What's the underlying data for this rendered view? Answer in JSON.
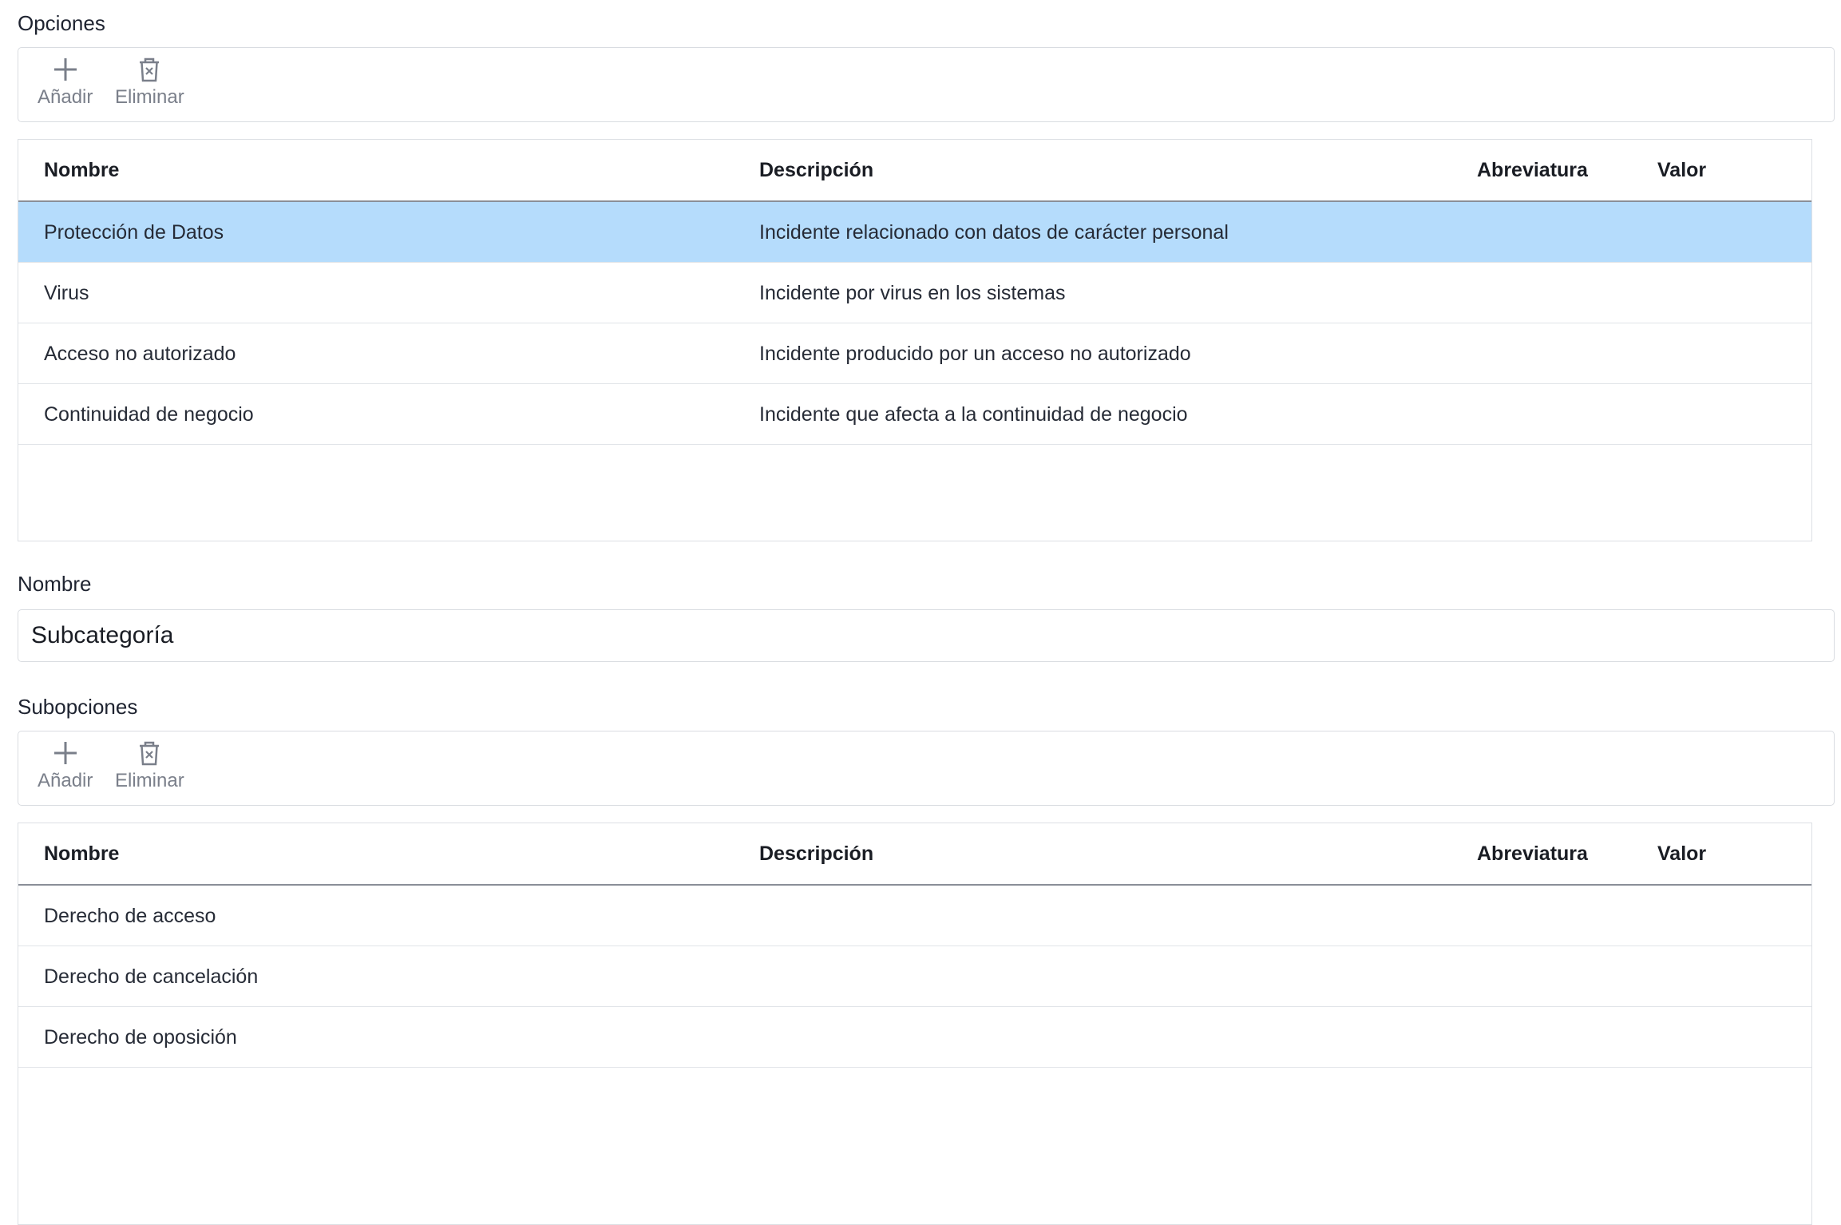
{
  "opciones": {
    "label": "Opciones",
    "toolbar": {
      "add_label": "Añadir",
      "delete_label": "Eliminar",
      "add_icon": "plus-icon",
      "delete_icon": "trash-icon"
    },
    "columns": {
      "nombre": "Nombre",
      "descripcion": "Descripción",
      "abreviatura": "Abreviatura",
      "valor": "Valor"
    },
    "rows": [
      {
        "nombre": "Protección de Datos",
        "descripcion": "Incidente relacionado con datos de carácter personal",
        "abreviatura": "",
        "valor": "",
        "selected": true
      },
      {
        "nombre": "Virus",
        "descripcion": "Incidente por virus en los sistemas",
        "abreviatura": "",
        "valor": "",
        "selected": false
      },
      {
        "nombre": "Acceso no autorizado",
        "descripcion": "Incidente producido por un acceso no autorizado",
        "abreviatura": "",
        "valor": "",
        "selected": false
      },
      {
        "nombre": "Continuidad de negocio",
        "descripcion": "Incidente que afecta a la continuidad de negocio",
        "abreviatura": "",
        "valor": "",
        "selected": false
      }
    ]
  },
  "nombre_field": {
    "label": "Nombre",
    "value": "Subcategoría"
  },
  "subopciones": {
    "label": "Subopciones",
    "toolbar": {
      "add_label": "Añadir",
      "delete_label": "Eliminar",
      "add_icon": "plus-icon",
      "delete_icon": "trash-icon"
    },
    "columns": {
      "nombre": "Nombre",
      "descripcion": "Descripción",
      "abreviatura": "Abreviatura",
      "valor": "Valor"
    },
    "rows": [
      {
        "nombre": "Derecho de acceso",
        "descripcion": "",
        "abreviatura": "",
        "valor": "",
        "selected": false
      },
      {
        "nombre": "Derecho de cancelación",
        "descripcion": "",
        "abreviatura": "",
        "valor": "",
        "selected": false
      },
      {
        "nombre": "Derecho de oposición",
        "descripcion": "",
        "abreviatura": "",
        "valor": "",
        "selected": false
      }
    ]
  },
  "colors": {
    "selected_row": "#b5dcfc",
    "border": "#d9dce1",
    "header_rule": "#8a8f98",
    "icon": "#7a7f8a"
  }
}
